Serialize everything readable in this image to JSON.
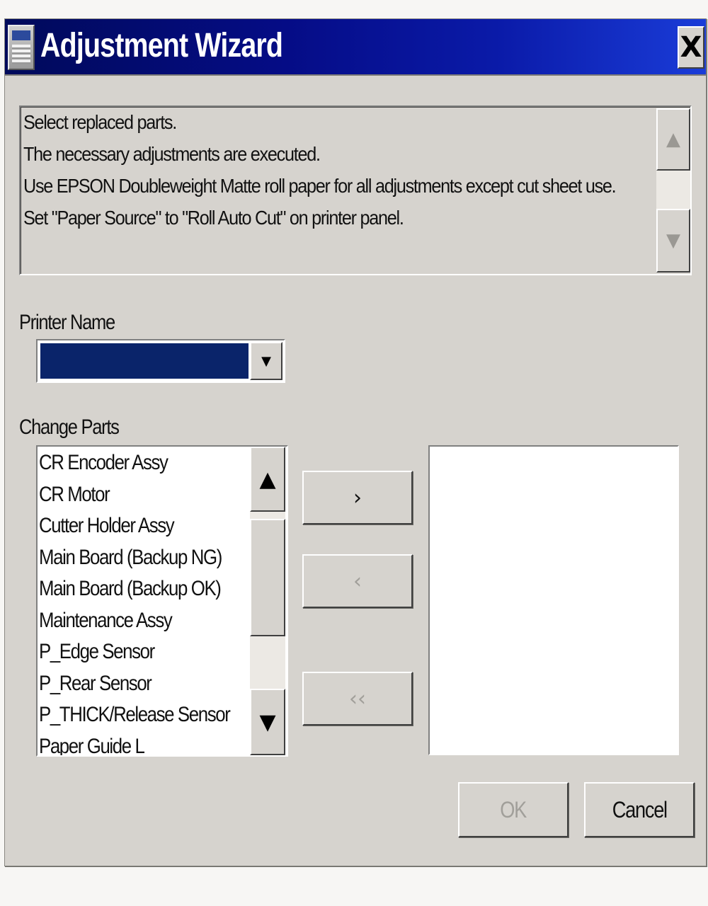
{
  "window": {
    "title": "Adjustment Wizard",
    "close_glyph": "X",
    "icon": "app-window-icon"
  },
  "message": {
    "lines": [
      "Select replaced parts.",
      "The necessary adjustments are executed.",
      "Use EPSON Doubleweight Matte roll paper for all adjustments except cut sheet use.",
      "Set \"Paper Source\" to \"Roll Auto Cut\" on printer panel."
    ]
  },
  "printer": {
    "label": "Printer Name",
    "selected_value": ""
  },
  "parts": {
    "label": "Change Parts",
    "items": [
      "CR Encoder Assy",
      "CR Motor",
      "Cutter Holder Assy",
      "Main Board (Backup NG)",
      "Main Board (Backup OK)",
      "Maintenance Assy",
      "P_Edge Sensor",
      "P_Rear Sensor",
      "P_THICK/Release Sensor",
      "Paper Guide L"
    ],
    "selected_items": []
  },
  "transfer_buttons": {
    "add": "›",
    "remove": "‹",
    "remove_all": "‹‹"
  },
  "scroll_arrows": {
    "up": "▲",
    "down": "▼",
    "dropdown": "▼"
  },
  "actions": {
    "ok": "OK",
    "cancel": "Cancel"
  },
  "colors": {
    "title_gradient_start": "#000a5a",
    "title_gradient_end": "#1a3cd8",
    "selection": "#0a246a",
    "dialog_bg": "#d6d3ce"
  }
}
